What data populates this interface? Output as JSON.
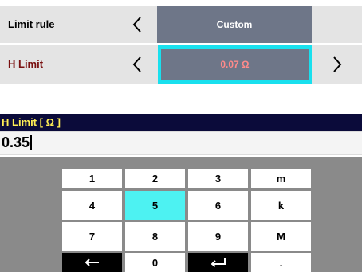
{
  "settings": {
    "limit_rule": {
      "label": "Limit rule",
      "value": "Custom"
    },
    "h_limit": {
      "label": "H Limit",
      "value": "0.07 Ω"
    }
  },
  "colors": {
    "h_limit_label": "#7a1010",
    "h_limit_value": "#ff8a8a",
    "selected_border": "#19e0ee",
    "input_header_text": "#ffee55",
    "active_key": "#4df2f2"
  },
  "input": {
    "title": "H Limit [ Ω ]",
    "value": "0.35"
  },
  "keypad": {
    "keys": [
      {
        "label": "1"
      },
      {
        "label": "2"
      },
      {
        "label": "3"
      },
      {
        "label": "m"
      },
      {
        "label": "4"
      },
      {
        "label": "5"
      },
      {
        "label": "6"
      },
      {
        "label": "k"
      },
      {
        "label": "7"
      },
      {
        "label": "8"
      },
      {
        "label": "9"
      },
      {
        "label": "M"
      },
      {
        "label": "",
        "icon": "backspace-arrow-icon"
      },
      {
        "label": "0"
      },
      {
        "label": "",
        "icon": "enter-icon"
      },
      {
        "label": "."
      }
    ],
    "active_key": "5"
  }
}
